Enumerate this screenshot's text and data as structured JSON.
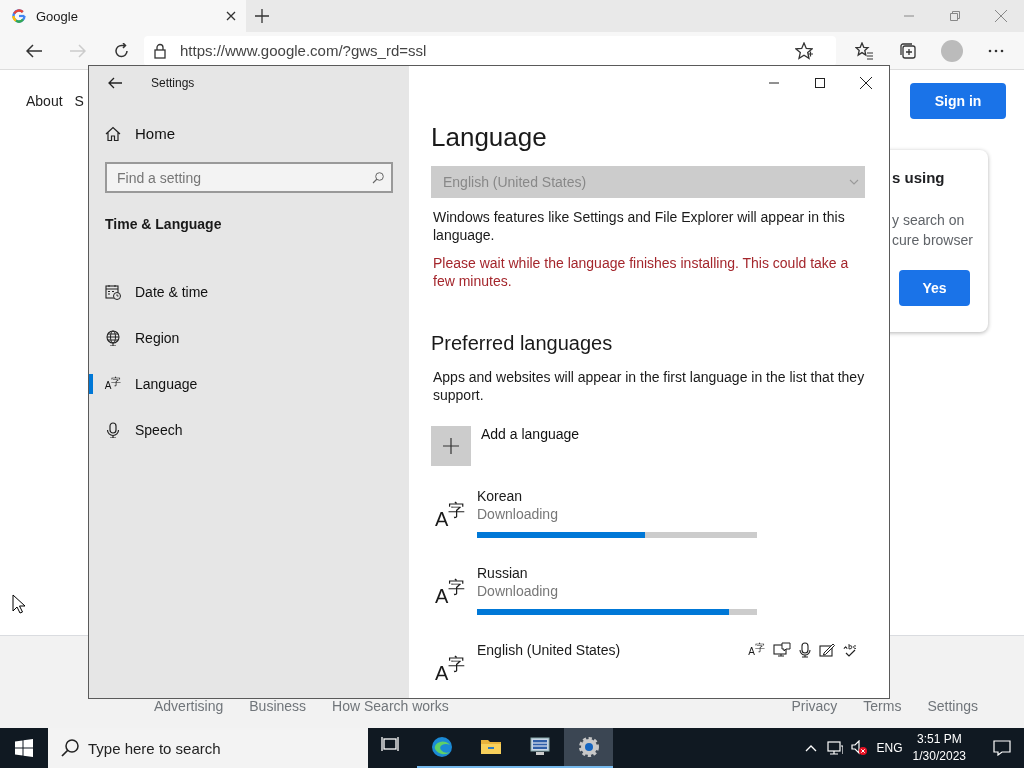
{
  "browser": {
    "tab_title": "Google",
    "url": "https://www.google.com/?gws_rd=ssl",
    "forward_disabled": true
  },
  "page": {
    "top_links": [
      "About",
      "S"
    ],
    "sign_in": "Sign in",
    "prompt": {
      "lines": [
        "s using",
        "y search on",
        "cure browser"
      ],
      "button": "Yes"
    },
    "footer_left": [
      "Advertising",
      "Business",
      "How Search works"
    ],
    "footer_right": [
      "Privacy",
      "Terms",
      "Settings"
    ]
  },
  "settings": {
    "title": "Settings",
    "home": "Home",
    "search_placeholder": "Find a setting",
    "section": "Time & Language",
    "nav": [
      {
        "label": "Date & time",
        "selected": false
      },
      {
        "label": "Region",
        "selected": false
      },
      {
        "label": "Language",
        "selected": true,
        "glyph": "A$^{字}$"
      },
      {
        "label": "Speech",
        "selected": false
      }
    ],
    "heading": "Language",
    "display_language": {
      "value": "English (United States)",
      "disabled": true
    },
    "description": "Windows features like Settings and File Explorer will appear in this language.",
    "warning": "Please wait while the language finishes installing. This could take a few minutes.",
    "preferred_heading": "Preferred languages",
    "preferred_description": "Apps and websites will appear in the first language in the list that they support.",
    "add_language": "Add a language",
    "languages": [
      {
        "glyph": "A$^{字}$",
        "name": "Korean",
        "status": "Downloading",
        "level": 0.6
      },
      {
        "glyph": "A$^{字}$",
        "name": "Russian",
        "status": "Downloading",
        "level": 0.9
      },
      {
        "glyph": "A$^{字}$",
        "name": "English (United States)",
        "feature_glyph": "A$^{字}$"
      }
    ]
  },
  "taskbar": {
    "search_placeholder": "Type here to search",
    "apps": [
      {
        "kind": "taskview",
        "running": false,
        "selected": false
      },
      {
        "kind": "browser",
        "running": true,
        "selected": false
      },
      {
        "kind": "folder",
        "running": true,
        "selected": false
      },
      {
        "kind": "remote",
        "running": true,
        "selected": false
      },
      {
        "kind": "gear",
        "running": true,
        "selected": true
      }
    ],
    "language": "ENG",
    "time": "3:51 PM",
    "date": "1/30/2023"
  }
}
